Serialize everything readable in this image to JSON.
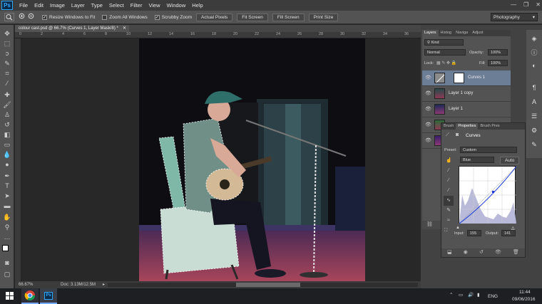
{
  "app": {
    "logo": "Ps"
  },
  "menu": [
    "File",
    "Edit",
    "Image",
    "Layer",
    "Type",
    "Select",
    "Filter",
    "View",
    "Window",
    "Help"
  ],
  "window_controls": [
    "—",
    "❐",
    "✕"
  ],
  "options": {
    "resize_windows": "Resize Windows to Fit",
    "zoom_all": "Zoom All Windows",
    "scrubby_zoom": "Scrubby Zoom",
    "actual_pixels": "Actual Pixels",
    "fit_screen": "Fit Screen",
    "fill_screen": "Fill Screen",
    "print_size": "Print Size",
    "workspace": "Photography"
  },
  "document": {
    "tab_title": "colour cast.psd @ 66.7% (Curves 1, Layer Mask/8) *",
    "ruler_h": [
      "0",
      "2",
      "4",
      "6",
      "8",
      "10",
      "12",
      "14",
      "16",
      "18",
      "20",
      "22",
      "24",
      "26",
      "28",
      "30",
      "32",
      "34",
      "36"
    ],
    "zoom": "66.67%",
    "doc_info": "Doc: 3.13M/12.5M"
  },
  "layers_panel": {
    "tabs": [
      "Layers",
      "Histog",
      "Naviga",
      "Adjust"
    ],
    "kind_label": "Kind",
    "blend_mode": "Normal",
    "opacity_label": "Opacity:",
    "opacity_value": "100%",
    "lock_label": "Lock:",
    "fill_label": "Fill:",
    "fill_value": "100%",
    "layers": [
      {
        "name": "Curves 1"
      },
      {
        "name": "Layer 1 copy"
      },
      {
        "name": "Layer 1"
      },
      {
        "name": ""
      },
      {
        "name": ""
      }
    ]
  },
  "properties_panel": {
    "tabs": [
      "Brush",
      "Properties",
      "Brush Pres"
    ],
    "title": "Curves",
    "preset_label": "Preset:",
    "preset_value": "Custom",
    "channel": "Blue",
    "auto_label": "Auto",
    "input_label": "Input:",
    "input_value": "155",
    "output_label": "Output:",
    "output_value": "141"
  },
  "taskbar": {
    "lang": "ENG",
    "time": "11:44",
    "date": "09/06/2016"
  }
}
